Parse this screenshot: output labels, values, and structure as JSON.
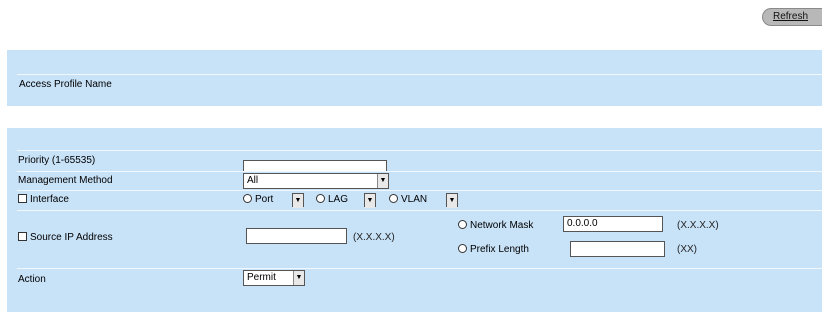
{
  "toolbar": {
    "refresh_label": "Refresh"
  },
  "profile_panel": {
    "name_label": "Access Profile Name"
  },
  "rule_panel": {
    "priority_label": "Priority (1-65535)",
    "priority_value": "",
    "management_method_label": "Management Method",
    "management_method_value": "All",
    "interface_label": "Interface",
    "port_label": "Port",
    "lag_label": "LAG",
    "vlan_label": "VLAN",
    "source_ip_label": "Source IP Address",
    "source_ip_value": "",
    "source_ip_hint": "(X.X.X.X)",
    "network_mask_label": "Network Mask",
    "network_mask_value": "0.0.0.0",
    "network_mask_hint": "(X.X.X.X)",
    "prefix_length_label": "Prefix Length",
    "prefix_length_value": "",
    "prefix_length_hint": "(XX)",
    "action_label": "Action",
    "action_value": "Permit"
  }
}
